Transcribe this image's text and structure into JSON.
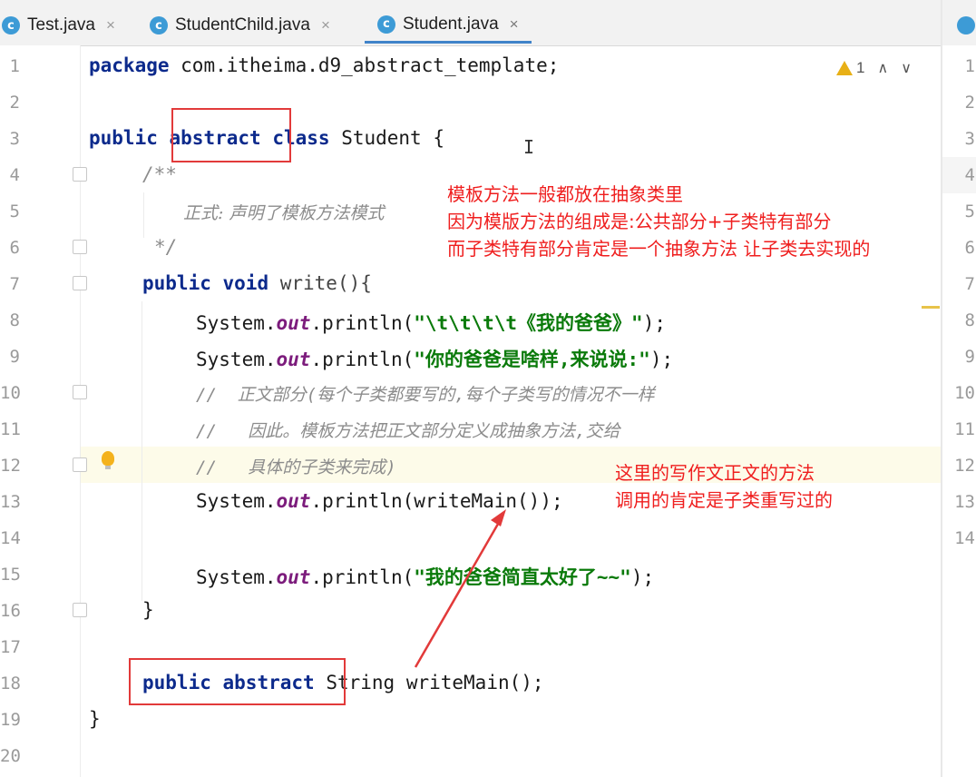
{
  "tabs": [
    {
      "label": "Test.java",
      "active": false
    },
    {
      "label": "StudentChild.java",
      "active": false
    },
    {
      "label": "Student.java",
      "active": true
    }
  ],
  "tab_icon_letter": "c",
  "tab_close": "×",
  "inspection": {
    "warning_count": "1"
  },
  "line_numbers": [
    "1",
    "2",
    "3",
    "4",
    "5",
    "6",
    "7",
    "8",
    "9",
    "10",
    "11",
    "12",
    "13",
    "14",
    "15",
    "16",
    "17",
    "18",
    "19",
    "20"
  ],
  "right_pane_line_numbers": [
    "1",
    "2",
    "3",
    "4",
    "5",
    "6",
    "7",
    "8",
    "9",
    "10",
    "11",
    "12",
    "13",
    "14"
  ],
  "code": {
    "l1_kw": "package",
    "l1_rest": " com.itheima.d9_abstract_template;",
    "l3_public": "public",
    "l3_abstract": "abstract",
    "l3_class": "class",
    "l3_name": " Student {",
    "l4": "/**",
    "l5": "正式: 声明了模板方法模式",
    "l6": "*/",
    "l7_public": "public",
    "l7_void": "void",
    "l7_rest": " write(){",
    "sys": "System.",
    "out": "out",
    "println": ".println(",
    "l8_str": "\"\\t\\t\\t\\t《我的爸爸》\"",
    "l8_end": ");",
    "l9_str": "\"你的爸爸是啥样,来说说:\"",
    "l9_end": ");",
    "l10": "//  正文部分(每个子类都要写的,每个子类写的情况不一样",
    "l11": "//   因此。模板方法把正文部分定义成抽象方法,交给",
    "l12": "//   具体的子类来完成)",
    "l13_rest": "writeMain());",
    "l15_str": "\"我的爸爸简直太好了~~\"",
    "l15_end": ");",
    "l16": "}",
    "l18_public": "public",
    "l18_abstract": "abstract",
    "l18_rest": " String writeMain();",
    "l19": "}"
  },
  "notes": {
    "top": "模板方法一般都放在抽象类里\n因为模版方法的组成是:公共部分+子类特有部分\n而子类特有部分肯定是一个抽象方法 让子类去实现的",
    "bottom": "这里的写作文正文的方法\n调用的肯定是子类重写过的"
  },
  "colors": {
    "annotation_red": "#ef1e1e",
    "keyword": "#0c2a8c",
    "string": "#0a7a0a",
    "field": "#7c1c7c",
    "comment": "#8c8c8c"
  }
}
